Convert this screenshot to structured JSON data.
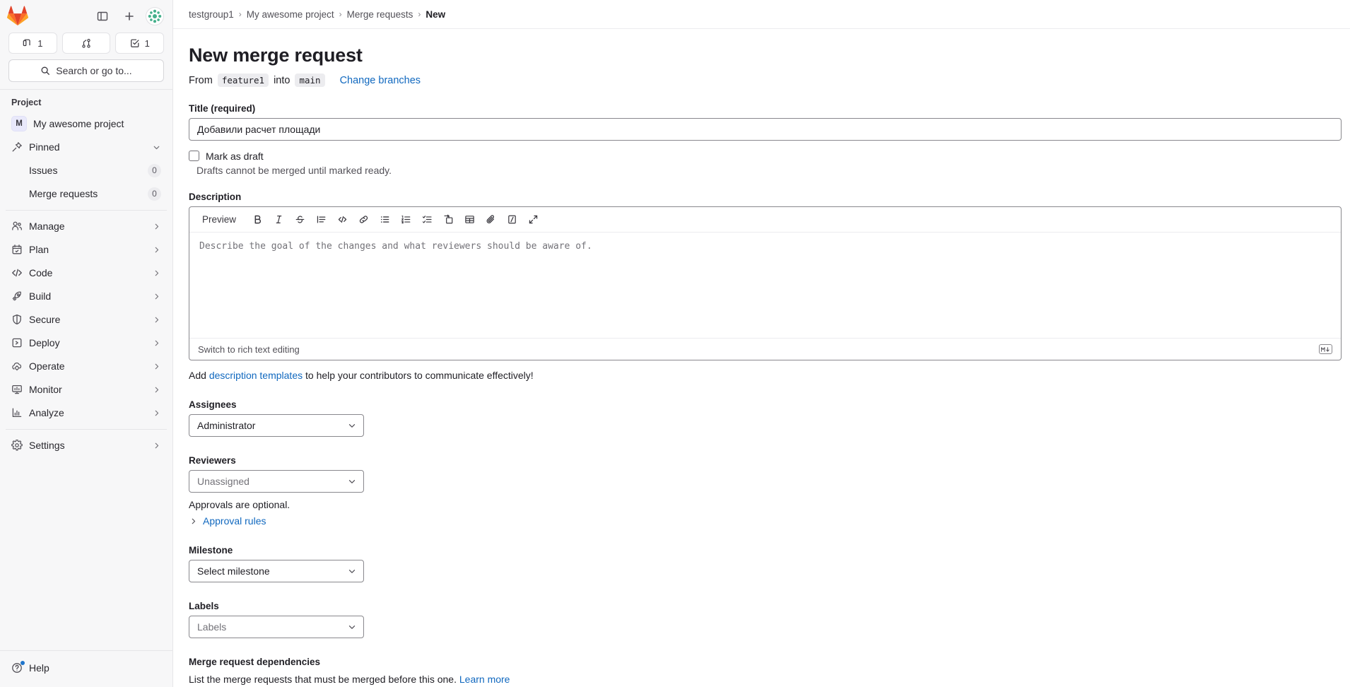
{
  "sidebar": {
    "top_actions": [
      {
        "name": "toggle-sidebar",
        "icon": "panel-icon"
      },
      {
        "name": "create-new",
        "icon": "plus-icon"
      },
      {
        "name": "user-avatar",
        "icon": "avatar-icon"
      }
    ],
    "counts": [
      {
        "icon": "merge-request-icon",
        "label": "1"
      },
      {
        "icon": "merge-icon",
        "label": ""
      },
      {
        "icon": "todo-icon",
        "label": "1"
      }
    ],
    "search": {
      "placeholder": "Search or go to...",
      "icon": "search-icon"
    },
    "section_label": "Project",
    "project": {
      "initial": "M",
      "name": "My awesome project"
    },
    "pinned": {
      "label": "Pinned",
      "icon": "pin-icon"
    },
    "pinned_items": [
      {
        "label": "Issues",
        "badge": "0"
      },
      {
        "label": "Merge requests",
        "badge": "0"
      }
    ],
    "items": [
      {
        "label": "Manage",
        "icon": "users-icon"
      },
      {
        "label": "Plan",
        "icon": "calendar-icon"
      },
      {
        "label": "Code",
        "icon": "code-icon"
      },
      {
        "label": "Build",
        "icon": "rocket-icon"
      },
      {
        "label": "Secure",
        "icon": "shield-icon"
      },
      {
        "label": "Deploy",
        "icon": "deploy-icon"
      },
      {
        "label": "Operate",
        "icon": "cloud-gear-icon"
      },
      {
        "label": "Monitor",
        "icon": "monitor-icon"
      },
      {
        "label": "Analyze",
        "icon": "chart-icon"
      }
    ],
    "settings": {
      "label": "Settings",
      "icon": "gear-icon"
    },
    "help": {
      "label": "Help",
      "icon": "question-circle-icon"
    }
  },
  "breadcrumb": [
    {
      "label": "testgroup1",
      "current": false
    },
    {
      "label": "My awesome project",
      "current": false
    },
    {
      "label": "Merge requests",
      "current": false
    },
    {
      "label": "New",
      "current": true
    }
  ],
  "breadcrumb_separator": "›",
  "page": {
    "title": "New merge request",
    "from_word": "From",
    "source_branch": "feature1",
    "into_word": "into",
    "target_branch": "main",
    "change_branches": "Change branches"
  },
  "title_field": {
    "label": "Title (required)",
    "value": "Добавили расчет площади"
  },
  "draft": {
    "checkbox_label": "Mark as draft",
    "help_text": "Drafts cannot be merged until marked ready.",
    "checked": false
  },
  "description": {
    "label": "Description",
    "preview_label": "Preview",
    "toolbar": [
      {
        "name": "bold-icon",
        "title": "Bold"
      },
      {
        "name": "italic-icon",
        "title": "Italic"
      },
      {
        "name": "strikethrough-icon",
        "title": "Strikethrough"
      },
      {
        "name": "quote-icon",
        "title": "Insert a quote"
      },
      {
        "name": "code-icon",
        "title": "Insert code"
      },
      {
        "name": "link-icon",
        "title": "Insert a link"
      },
      {
        "name": "bullet-list-icon",
        "title": "Add a bullet list"
      },
      {
        "name": "numbered-list-icon",
        "title": "Add a numbered list"
      },
      {
        "name": "task-list-icon",
        "title": "Add a checklist"
      },
      {
        "name": "indent-icon",
        "title": "Add a collapsible section"
      },
      {
        "name": "table-icon",
        "title": "Add a table"
      },
      {
        "name": "attach-icon",
        "title": "Attach a file or image"
      },
      {
        "name": "suggestion-icon",
        "title": "Insert suggestion"
      },
      {
        "name": "fullscreen-icon",
        "title": "Go full screen"
      }
    ],
    "placeholder": "Describe the goal of the changes and what reviewers should be aware of.",
    "switch_label": "Switch to rich text editing",
    "markdown_icon": "markdown-icon",
    "templates_prefix": "Add ",
    "templates_link": "description templates",
    "templates_suffix": " to help your contributors to communicate effectively!"
  },
  "assignees": {
    "label": "Assignees",
    "value": "Administrator"
  },
  "reviewers": {
    "label": "Reviewers",
    "value": "Unassigned",
    "approvals_note": "Approvals are optional.",
    "approval_rules": "Approval rules"
  },
  "milestone": {
    "label": "Milestone",
    "value": "Select milestone"
  },
  "labels": {
    "label": "Labels",
    "value": "Labels"
  },
  "dependencies": {
    "title": "Merge request dependencies",
    "text_prefix": "List the merge requests that must be merged before this one. ",
    "link": "Learn more"
  },
  "colors": {
    "accent_link": "#1068bf",
    "brand_orange": "#e24329",
    "sidebar_bg": "#f7f7f8",
    "border": "#89888d"
  }
}
